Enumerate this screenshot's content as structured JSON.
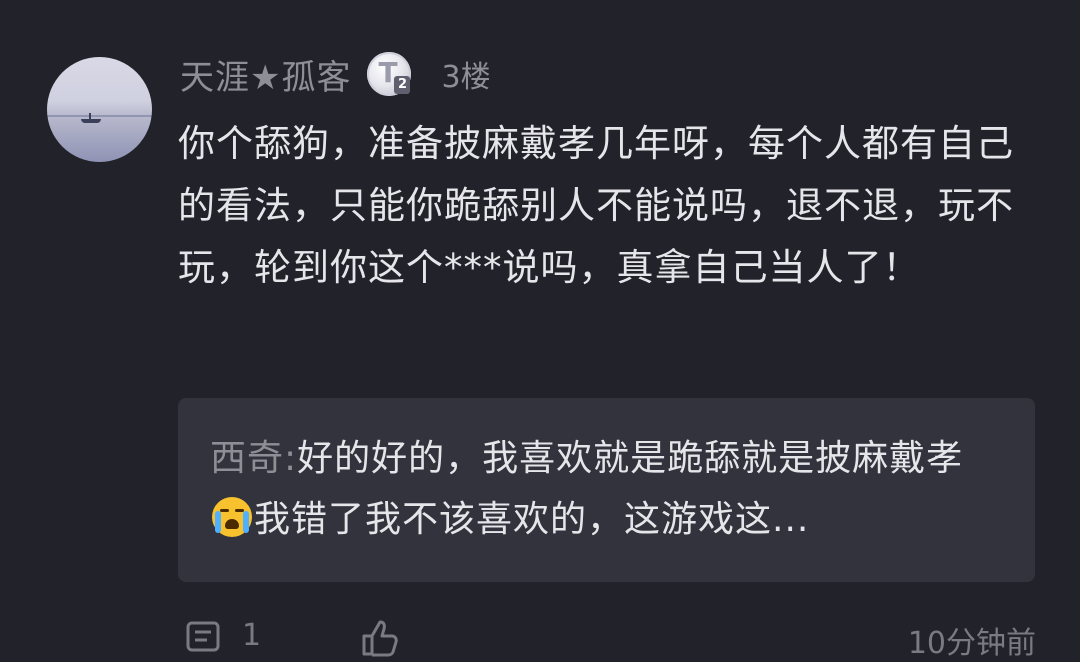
{
  "post": {
    "username": "天涯★孤客",
    "level_badge": {
      "letter": "T",
      "number": "2"
    },
    "floor": "3楼",
    "comment": "你个舔狗，准备披麻戴孝几年呀，每个人都有自己的看法，只能你跪舔别人不能说吗，退不退，玩不玩，轮到你这个***说吗，真拿自己当人了！",
    "colors": {
      "background": "#22222b",
      "reply_background": "#33333d",
      "text": "#e6e6ea",
      "muted": "#8e8e96"
    }
  },
  "reply": {
    "author": "西奇",
    "separator": ":",
    "text_before_emoji": "好的好的，我喜欢就是跪舔就是披麻戴孝",
    "emoji": "loudly-crying-face-icon",
    "text_after_emoji": "我错了我不该喜欢的，这游戏这..."
  },
  "footer": {
    "comment_icon": "comment-icon",
    "reply_count": "1",
    "like_icon": "thumbs-up-icon",
    "time": "10分钟前"
  }
}
